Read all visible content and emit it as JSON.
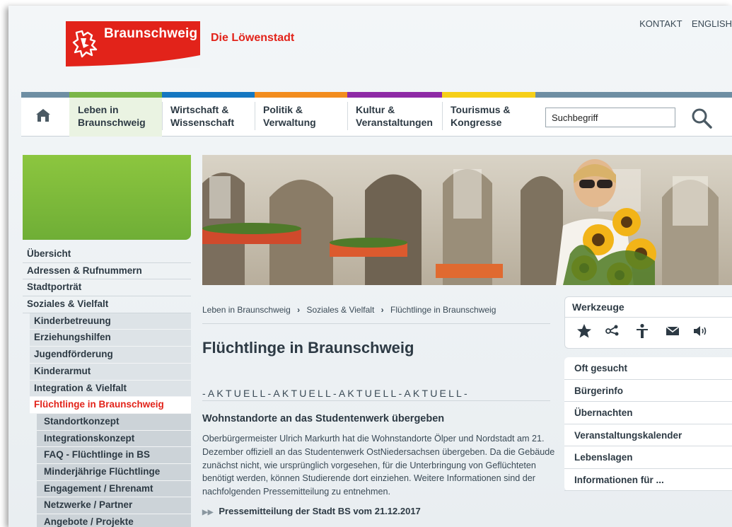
{
  "header": {
    "logo_text": "Braunschweig",
    "tagline": "Die Löwenstadt",
    "top_links": [
      "KONTAKT",
      "ENGLISH"
    ]
  },
  "nav": {
    "items": [
      {
        "label": "Leben in Braunschweig",
        "line1": "Leben in",
        "line2": "Braunschweig",
        "color": "#7ab648"
      },
      {
        "label": "Wirtschaft & Wissenschaft",
        "line1": "Wirtschaft &",
        "line2": "Wissenschaft",
        "color": "#1577c1"
      },
      {
        "label": "Politik & Verwaltung",
        "line1": "Politik &",
        "line2": "Verwaltung",
        "color": "#f28c1e"
      },
      {
        "label": "Kultur & Veranstaltungen",
        "line1": "Kultur &",
        "line2": "Veranstaltungen",
        "color": "#8e2aa6"
      },
      {
        "label": "Tourismus & Kongresse",
        "line1": "Tourismus &",
        "line2": "Kongresse",
        "color": "#f6cf18"
      }
    ],
    "search_value": "Suchbegriff"
  },
  "sidebar": {
    "items": [
      {
        "label": "Übersicht",
        "level": 1
      },
      {
        "label": "Adressen & Rufnummern",
        "level": 1
      },
      {
        "label": "Stadtporträt",
        "level": 1
      },
      {
        "label": "Soziales & Vielfalt",
        "level": 1
      },
      {
        "label": "Kinderbetreuung",
        "level": 2
      },
      {
        "label": "Erziehungshilfen",
        "level": 2
      },
      {
        "label": "Jugendförderung",
        "level": 2
      },
      {
        "label": "Kinderarmut",
        "level": 2
      },
      {
        "label": "Integration & Vielfalt",
        "level": 2
      },
      {
        "label": "Flüchtlinge in Braunschweig",
        "level": 2,
        "active": true
      },
      {
        "label": "Standortkonzept",
        "level": 3
      },
      {
        "label": "Integrationskonzept",
        "level": 3
      },
      {
        "label": "FAQ - Flüchtlinge in BS",
        "level": 3
      },
      {
        "label": "Minderjährige Flüchtlinge",
        "level": 3
      },
      {
        "label": "Engagement / Ehrenamt",
        "level": 3
      },
      {
        "label": "Netzwerke / Partner",
        "level": 3
      },
      {
        "label": "Angebote / Projekte",
        "level": 3
      }
    ]
  },
  "breadcrumb": {
    "items": [
      "Leben in Braunschweig",
      "Soziales & Vielfalt",
      "Flüchtlinge in Braunschweig"
    ],
    "separator": "›"
  },
  "main": {
    "title": "Flüchtlinge in Braunschweig",
    "aktuell": "-AKTUELL-AKTUELL-AKTUELL-AKTUELL-",
    "news_title": "Wohnstandorte an das Studentenwerk übergeben",
    "news_body": "Oberbürgermeister Ulrich Markurth hat die Wohnstandorte Ölper und Nordstadt am 21. Dezember offiziell an das Studentenwerk OstNiedersachsen übergeben. Da die Gebäude zunächst nicht, wie ursprünglich vorgesehen, für die Unterbringung von Geflüchteten benötigt werden, können Studierende dort einziehen. Weitere Informationen sind der nachfolgenden Pressemitteilung zu entnehmen.",
    "news_link": "Pressemitteilung der Stadt BS vom 21.12.2017"
  },
  "tools": {
    "title": "Werkzeuge",
    "icons": [
      "star-icon",
      "share-icon",
      "accessibility-icon",
      "mail-icon",
      "speaker-icon"
    ]
  },
  "quicklinks": {
    "items": [
      "Oft gesucht",
      "Bürgerinfo",
      "Übernachten",
      "Veranstaltungskalender",
      "Lebenslagen",
      "Informationen für ..."
    ]
  },
  "colors": {
    "brand_red": "#e2231a",
    "text_dark": "#2d3a44",
    "sidebar_green": "#8cc63f"
  }
}
